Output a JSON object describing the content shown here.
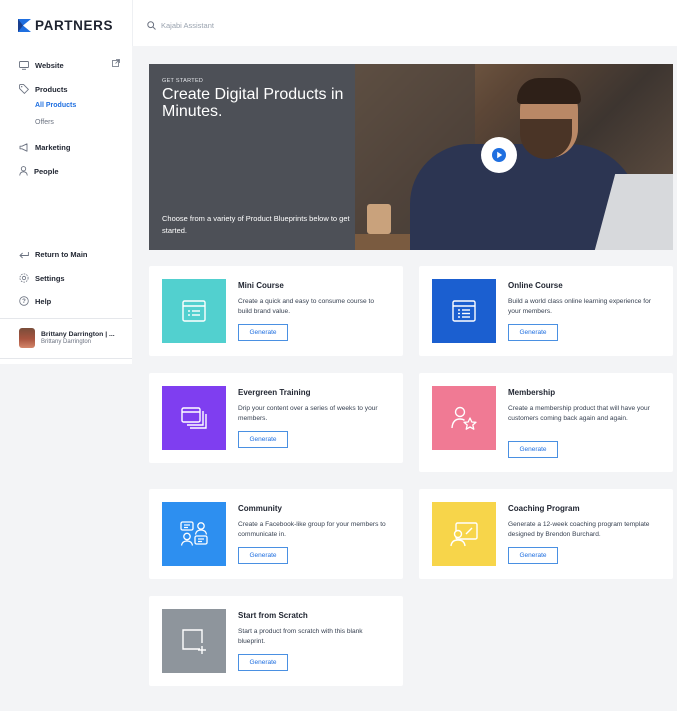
{
  "brand": {
    "logo_text": "PARTNERS"
  },
  "search": {
    "placeholder": "Kajabi Assistant"
  },
  "sidebar": {
    "website": "Website",
    "products": "Products",
    "all_products": "All Products",
    "offers": "Offers",
    "marketing": "Marketing",
    "people": "People",
    "return_to_main": "Return to Main",
    "settings": "Settings",
    "help": "Help"
  },
  "user": {
    "name": "Brittany Darrington | ...",
    "subtitle": "Brittany Darrington"
  },
  "hero": {
    "eyebrow": "GET STARTED",
    "title": "Create Digital Products in Minutes.",
    "description": "Choose from a variety of Product Blueprints below to get started."
  },
  "cards": [
    {
      "title": "Mini Course",
      "description": "Create a quick and easy to consume course to build brand value.",
      "button": "Generate",
      "color": "#52d0cf",
      "icon": "mini-course-icon"
    },
    {
      "title": "Online Course",
      "description": "Build a world class online learning experience for your members.",
      "button": "Generate",
      "color": "#1b5fd0",
      "icon": "online-course-icon"
    },
    {
      "title": "Evergreen Training",
      "description": "Drip your content over a series of weeks to your members.",
      "button": "Generate",
      "color": "#7f3ef0",
      "icon": "evergreen-training-icon"
    },
    {
      "title": "Membership",
      "description": "Create a membership product that will have your customers coming back again and again.",
      "button": "Generate",
      "color": "#f07a94",
      "icon": "membership-icon"
    },
    {
      "title": "Community",
      "description": "Create a Facebook-like group for your members to communicate in.",
      "button": "Generate",
      "color": "#2d8ff0",
      "icon": "community-icon"
    },
    {
      "title": "Coaching Program",
      "description": "Generate a 12-week coaching program template designed by Brendon Burchard.",
      "button": "Generate",
      "color": "#f7d54a",
      "icon": "coaching-program-icon"
    },
    {
      "title": "Start from Scratch",
      "description": "Start a product from scratch with this blank blueprint.",
      "button": "Generate",
      "color": "#8e959c",
      "icon": "start-from-scratch-icon"
    }
  ]
}
